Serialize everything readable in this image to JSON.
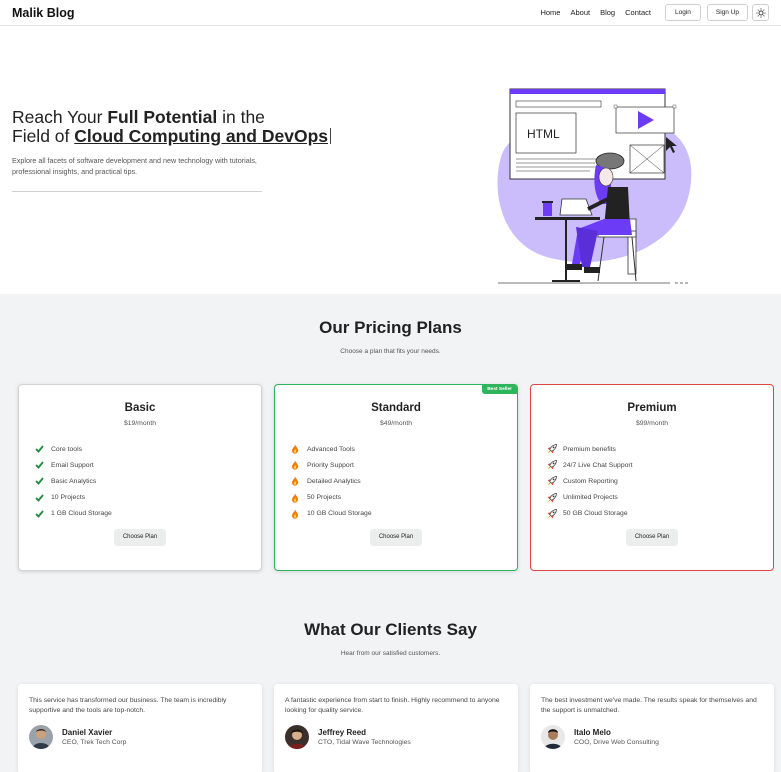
{
  "nav": {
    "brand": "Malik Blog",
    "links": [
      "Home",
      "About",
      "Blog",
      "Contact"
    ],
    "login": "Login",
    "signup": "Sign Up",
    "theme_icon": "sun-icon"
  },
  "hero": {
    "line1_a": "Reach Your ",
    "line1_b": "Full Potential",
    "line1_c": " in the",
    "line2_a": "Field of ",
    "line2_b": "Cloud Computing and DevOps",
    "subtitle": "Explore all facets of software development and new technology with tutorials, professional insights, and practical tips.",
    "illus_label": "HTML"
  },
  "pricing": {
    "title": "Our Pricing Plans",
    "subtitle": "Choose a plan that fits your needs.",
    "plans": [
      {
        "name": "Basic",
        "price": "$19/month",
        "features": [
          "Core tools",
          "Email Support",
          "Basic Analytics",
          "10 Projects",
          "1 GB Cloud Storage"
        ],
        "icon": "check-icon",
        "button": "Choose Plan"
      },
      {
        "name": "Standard",
        "price": "$49/month",
        "badge": "Best Seller",
        "features": [
          "Advanced Tools",
          "Priority Support",
          "Detailed Analytics",
          "50 Projects",
          "10 GB Cloud Storage"
        ],
        "icon": "fire-icon",
        "button": "Choose Plan"
      },
      {
        "name": "Premium",
        "price": "$99/month",
        "features": [
          "Premium benefits",
          "24/7 Live Chat Support",
          "Custom Reporting",
          "Unlimited Projects",
          "50 GB Cloud Storage"
        ],
        "icon": "rocket-icon",
        "button": "Choose Plan"
      }
    ]
  },
  "testimonials": {
    "title": "What Our Clients Say",
    "subtitle": "Hear from our satisfied customers.",
    "items": [
      {
        "quote": "This service has transformed our business. The team is incredibly supportive and the tools are top-notch.",
        "name": "Daniel Xavier",
        "role": "CEO, Trek Tech Corp"
      },
      {
        "quote": "A fantastic experience from start to finish. Highly recommend to anyone looking for quality service.",
        "name": "Jeffrey Reed",
        "role": "CTO, Tidal Wave Technologies"
      },
      {
        "quote": "The best investment we've made. The results speak for themselves and the support is unmatched.",
        "name": "Italo Melo",
        "role": "COO, Drive Web Consulting"
      }
    ]
  },
  "colors": {
    "accent_purple": "#6c3bf5",
    "success_green": "#2fb35b",
    "premium_red": "#e04545",
    "section_bg": "#f2f3f5"
  }
}
